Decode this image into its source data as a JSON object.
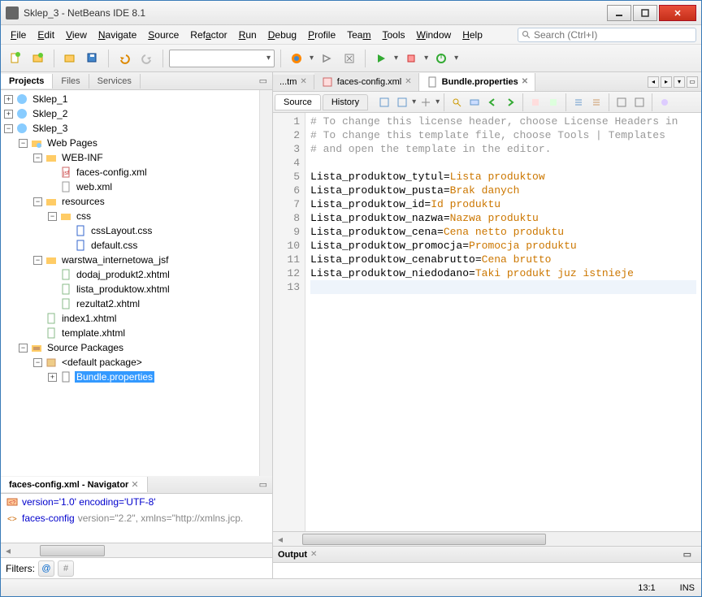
{
  "window": {
    "title": "Sklep_3 - NetBeans IDE 8.1"
  },
  "menu": [
    "File",
    "Edit",
    "View",
    "Navigate",
    "Source",
    "Refactor",
    "Run",
    "Debug",
    "Profile",
    "Team",
    "Tools",
    "Window",
    "Help"
  ],
  "search_placeholder": "Search (Ctrl+I)",
  "panels": {
    "projects_tabs": [
      "Projects",
      "Files",
      "Services"
    ],
    "navigator_title": "faces-config.xml - Navigator",
    "output_title": "Output",
    "filters_label": "Filters:"
  },
  "tree": {
    "roots": [
      {
        "label": "Sklep_1",
        "expanded": false
      },
      {
        "label": "Sklep_2",
        "expanded": false
      },
      {
        "label": "Sklep_3",
        "expanded": true
      }
    ],
    "sklep3": {
      "web_pages": "Web Pages",
      "web_inf": "WEB-INF",
      "faces_config": "faces-config.xml",
      "web_xml": "web.xml",
      "resources": "resources",
      "css": "css",
      "css_layout": "cssLayout.css",
      "default_css": "default.css",
      "warstwa": "warstwa_internetowa_jsf",
      "dodaj": "dodaj_produkt2.xhtml",
      "lista": "lista_produktow.xhtml",
      "rezultat": "rezultat2.xhtml",
      "index1": "index1.xhtml",
      "template": "template.xhtml",
      "source_packages": "Source Packages",
      "default_pkg": "<default package>",
      "bundle": "Bundle.properties"
    }
  },
  "navigator": {
    "line1_a": "version='1.0' encoding='UTF-8'",
    "line2_a": "faces-config",
    "line2_b": " version=\"2.2\", xmlns=\"http://xmlns.jcp."
  },
  "editor_tabs": {
    "tab1": "...tm",
    "tab2": "faces-config.xml",
    "tab3": "Bundle.properties"
  },
  "editor_subtabs": {
    "source": "Source",
    "history": "History"
  },
  "code": {
    "c1": "# To change this license header, choose License Headers in",
    "c2": "# To change this template file, choose Tools | Templates",
    "c3": "# and open the template in the editor.",
    "k5": "Lista_produktow_tytul=",
    "v5": "Lista produktow",
    "k6": "Lista_produktow_pusta=",
    "v6": "Brak danych",
    "k7": "Lista_produktow_id=",
    "v7": "Id produktu",
    "k8": "Lista_produktow_nazwa=",
    "v8": "Nazwa produktu",
    "k9": "Lista_produktow_cena=",
    "v9": "Cena netto produktu",
    "k10": "Lista_produktow_promocja=",
    "v10": "Promocja produktu",
    "k11": "Lista_produktow_cenabrutto=",
    "v11": "Cena brutto",
    "k12": "Lista_produktow_niedodano=",
    "v12": "Taki produkt juz istnieje"
  },
  "status": {
    "pos": "13:1",
    "mode": "INS"
  }
}
